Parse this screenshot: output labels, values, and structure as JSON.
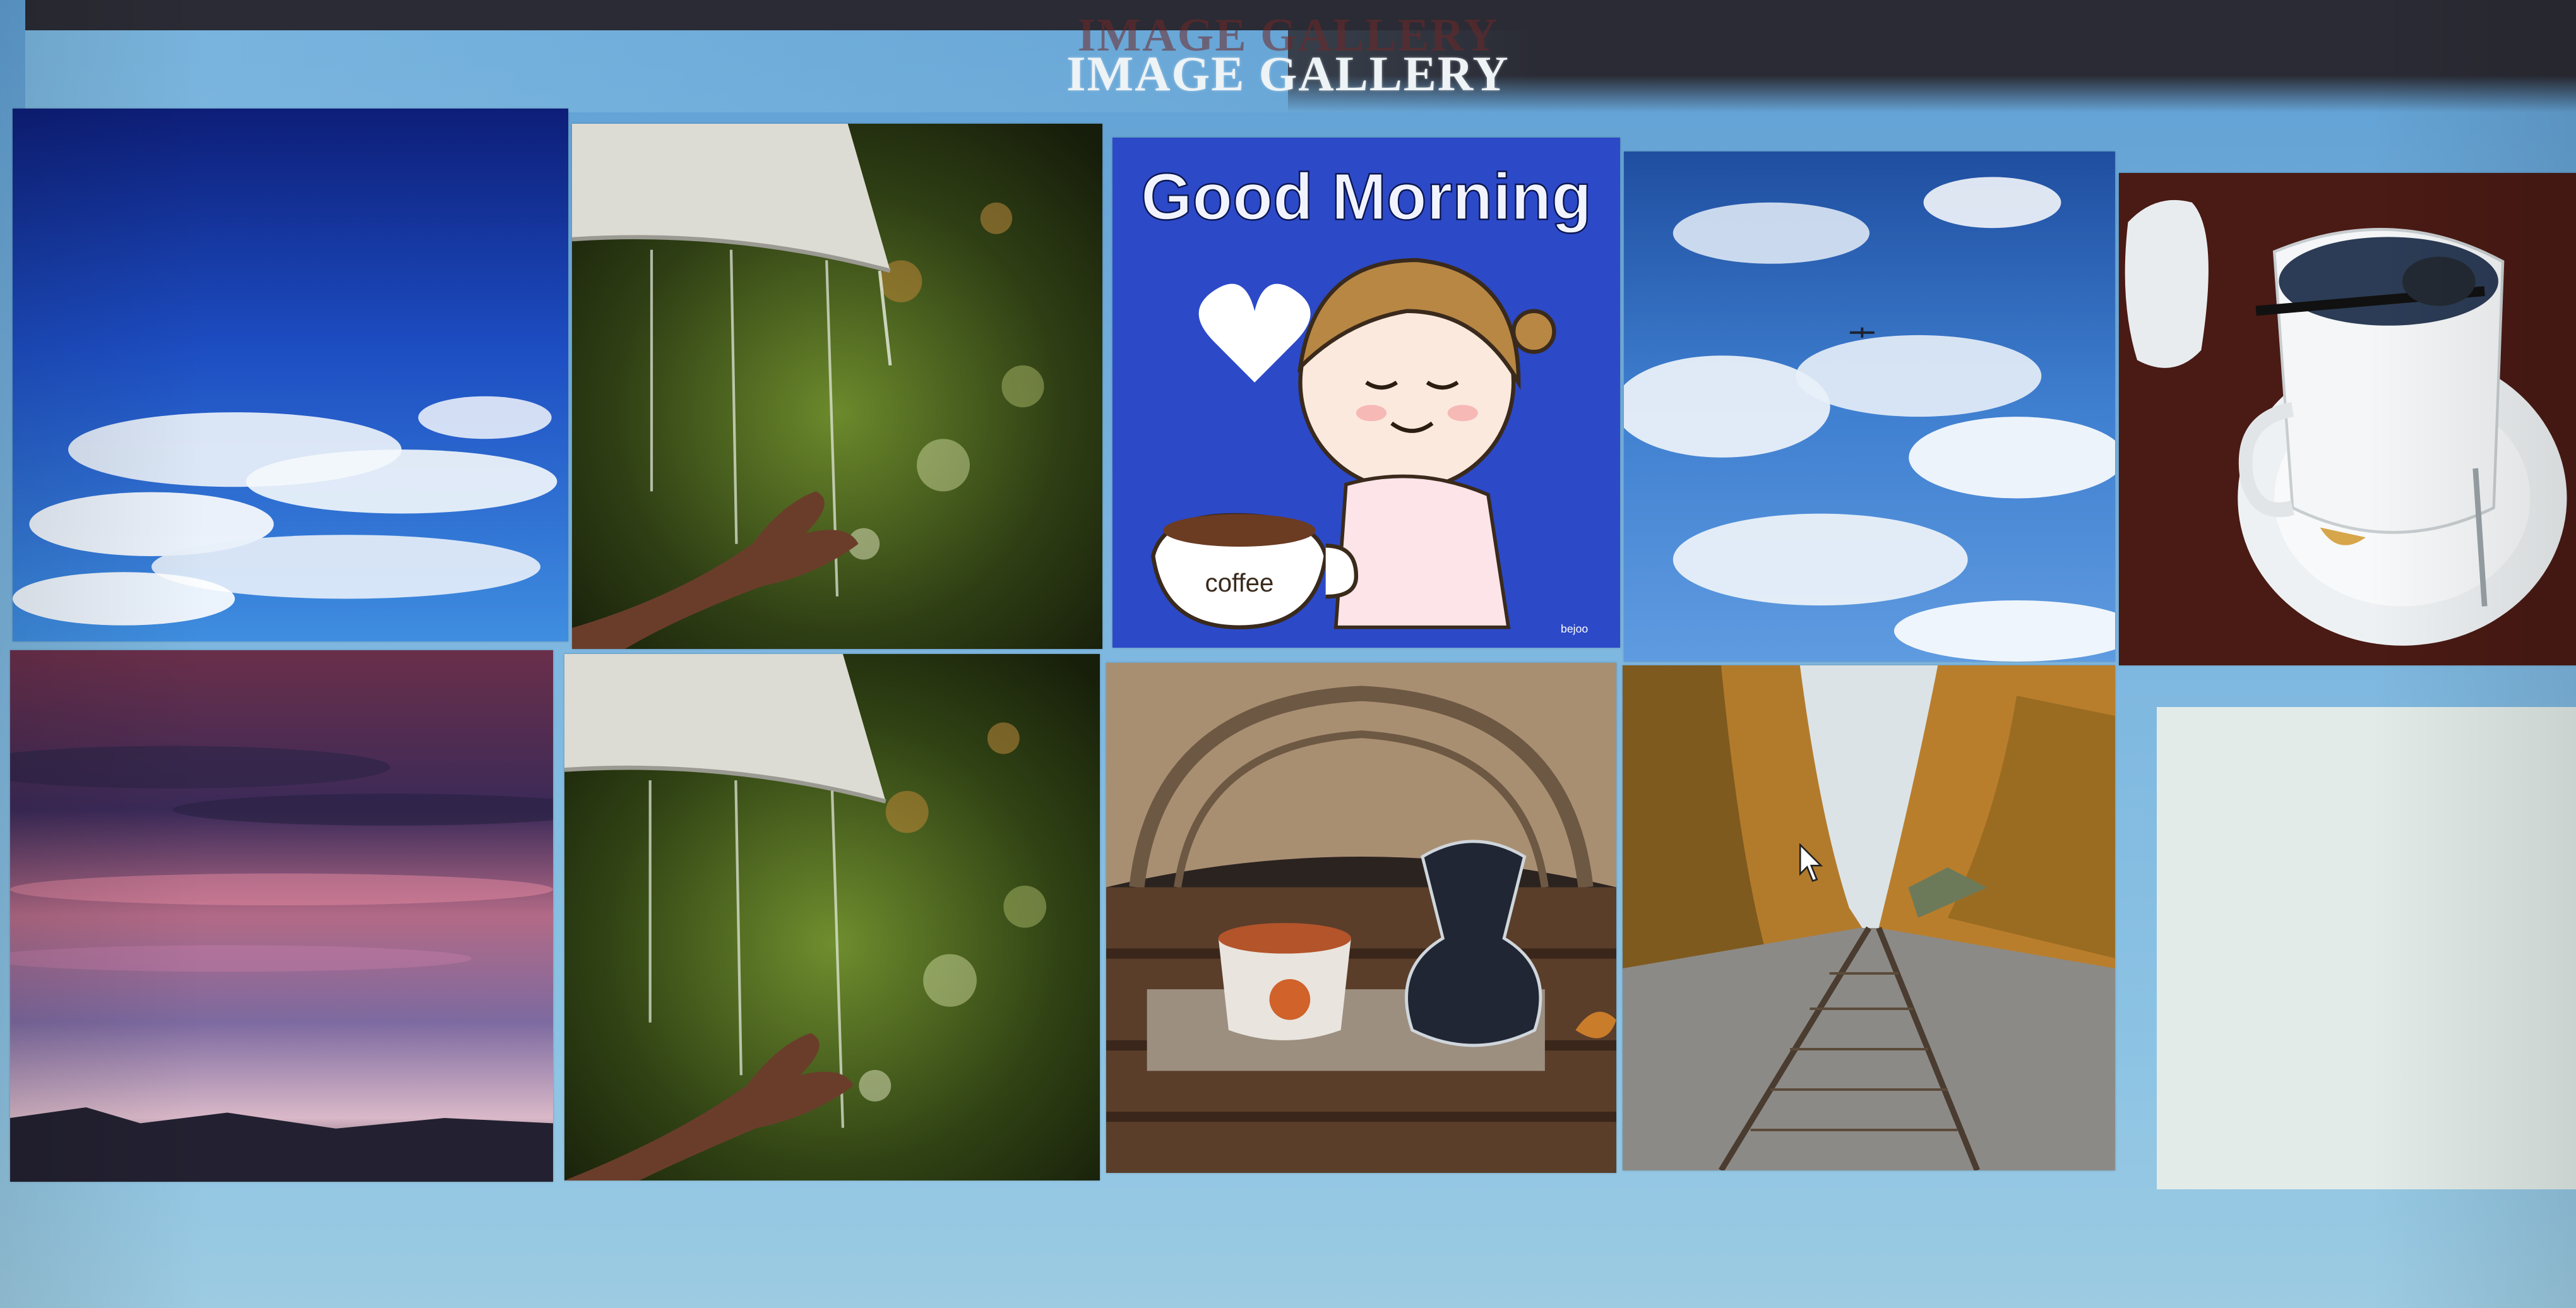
{
  "page": {
    "title": "IMAGE GALLERY",
    "background_color": "#79b3de",
    "header_color": "#2a2b34",
    "title_color": "#eef3f6"
  },
  "gallery": {
    "images": [
      {
        "name": "blue-sky-clouds",
        "row": 1,
        "col": 1
      },
      {
        "name": "hand-in-rain-umbrella",
        "row": 1,
        "col": 2
      },
      {
        "name": "good-morning-coffee-cartoon",
        "row": 1,
        "col": 3,
        "text": "Good Morning",
        "cup_text": "coffee",
        "signature": "bejoo"
      },
      {
        "name": "sky-with-clouds-airplane",
        "row": 1,
        "col": 4
      },
      {
        "name": "coffee-cup-on-saucer",
        "row": 1,
        "col": 5
      },
      {
        "name": "purple-sunset-sky",
        "row": 2,
        "col": 1
      },
      {
        "name": "hand-in-rain-umbrella",
        "row": 2,
        "col": 2
      },
      {
        "name": "coffee-pumpkin-mug-chemex",
        "row": 2,
        "col": 3
      },
      {
        "name": "autumn-railroad-tracks",
        "row": 2,
        "col": 4
      },
      {
        "name": "empty-placeholder",
        "row": 2,
        "col": 5
      }
    ]
  },
  "cursor": {
    "icon": "mouse-pointer-icon"
  }
}
